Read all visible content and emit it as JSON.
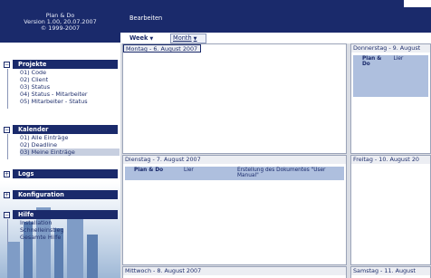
{
  "app": {
    "name": "Plan & Do",
    "version": "Version 1.00, 20.07.2007",
    "copyright": "© 1999-2007"
  },
  "topbar": {
    "menu_label": "Bearbeiten"
  },
  "view_tabs": {
    "week": "Week",
    "month": "Month"
  },
  "sidebar": {
    "projekte": {
      "title": "Projekte",
      "items": [
        "01) Code",
        "02) Client",
        "03) Status",
        "04) Status - Mitarbeiter",
        "05) Mitarbeiter - Status"
      ]
    },
    "kalender": {
      "title": "Kalender",
      "items": [
        "01) Alle Einträge",
        "02) Deadline",
        "03) Meine Einträge"
      ]
    },
    "logs": {
      "title": "Logs"
    },
    "konfiguration": {
      "title": "Konfiguration"
    },
    "hilfe": {
      "title": "Hilfe",
      "items": [
        "Installation",
        "Schnelleinstieg",
        "Gesamte Hilfe"
      ]
    }
  },
  "calendar": {
    "monday": {
      "label": "Montag - 6. August 2007"
    },
    "tuesday": {
      "label": "Dienstag - 7. August 2007",
      "entry": {
        "project": "Plan & Do",
        "person": "Lier",
        "title": "Erstellung des Dokumentes \"User Manual\""
      }
    },
    "wednesday": {
      "label": "Mittwoch - 8. August 2007"
    },
    "thursday": {
      "label": "Donnerstag - 9. August",
      "entry": {
        "project": "Plan & Do",
        "person": "Lier"
      }
    },
    "friday": {
      "label": "Freitag - 10. August 20"
    },
    "saturday": {
      "label": "Samstag - 11. August"
    }
  },
  "colors": {
    "navy": "#1a2a6b",
    "entry_bg": "#aebfde",
    "active_item": "#c7cfe0"
  }
}
